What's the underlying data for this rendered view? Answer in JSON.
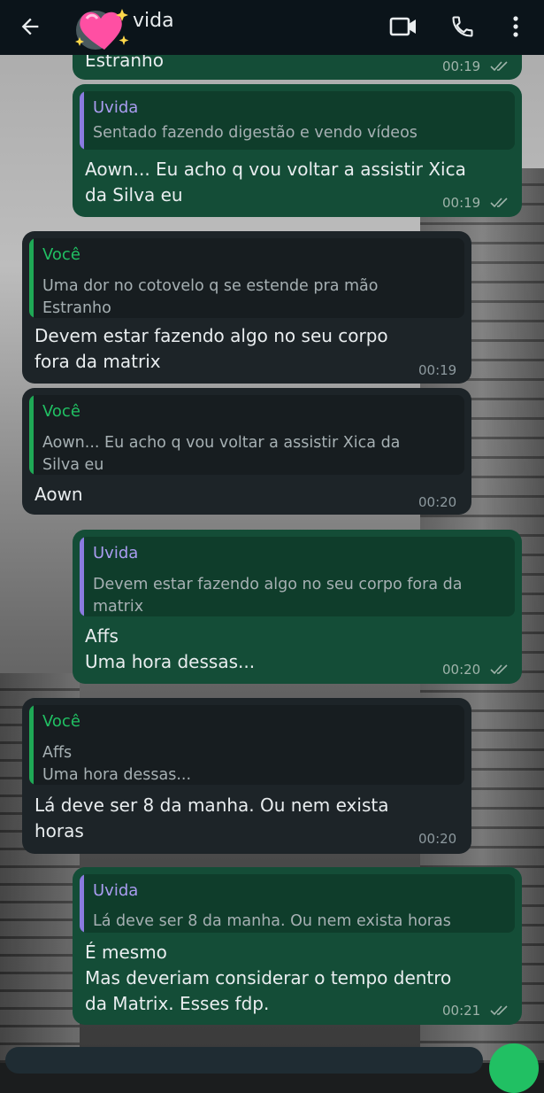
{
  "header": {
    "contact_name": "Uvida",
    "contact_name_visible": "vida"
  },
  "messages": [
    {
      "id": "m0",
      "direction": "out",
      "text": "Estranho",
      "time": "00:19",
      "status": "read"
    },
    {
      "id": "m1",
      "direction": "out",
      "quote": {
        "author": "Uvida",
        "text": "Sentado fazendo digestão e vendo vídeos"
      },
      "text": "Aown... Eu acho q vou voltar a assistir Xica\nda Silva eu",
      "time": "00:19",
      "status": "read"
    },
    {
      "id": "m2",
      "direction": "in",
      "quote": {
        "author": "Você",
        "text": "Uma dor no cotovelo q se estende pra mão\nEstranho"
      },
      "text": "Devem estar fazendo algo no seu corpo\nfora da matrix",
      "time": "00:19"
    },
    {
      "id": "m3",
      "direction": "in",
      "quote": {
        "author": "Você",
        "text": "Aown... Eu acho q vou voltar a assistir Xica da\nSilva eu"
      },
      "text": "Aown",
      "time": "00:20"
    },
    {
      "id": "m4",
      "direction": "out",
      "quote": {
        "author": "Uvida",
        "text": "Devem estar fazendo algo no seu corpo fora da\nmatrix"
      },
      "text": "Affs\nUma hora dessas...",
      "time": "00:20",
      "status": "read"
    },
    {
      "id": "m5",
      "direction": "in",
      "quote": {
        "author": "Você",
        "text": "Affs\nUma hora dessas..."
      },
      "text": "Lá deve ser 8 da manha. Ou nem exista\nhoras",
      "time": "00:20"
    },
    {
      "id": "m6",
      "direction": "out",
      "quote": {
        "author": "Uvida",
        "text": "Lá deve ser 8 da manha. Ou nem exista horas"
      },
      "text": "É mesmo\nMas deveriam considerar o tempo dentro\nda Matrix. Esses fdp.",
      "time": "00:21",
      "status": "read"
    }
  ],
  "icons": {
    "back": "arrow-left-icon",
    "video": "video-camera-icon",
    "call": "phone-icon",
    "menu": "more-vertical-icon",
    "avatar_sticker": "sparkling-hearts-icon",
    "read": "double-check-icon",
    "mic": "mic-icon"
  },
  "colors": {
    "outgoing_bubble": "#144d37",
    "incoming_bubble": "#1d2428",
    "accent_green": "#21c063",
    "quote_purple": "#a99cf0",
    "header_bg": "#0b141a"
  }
}
